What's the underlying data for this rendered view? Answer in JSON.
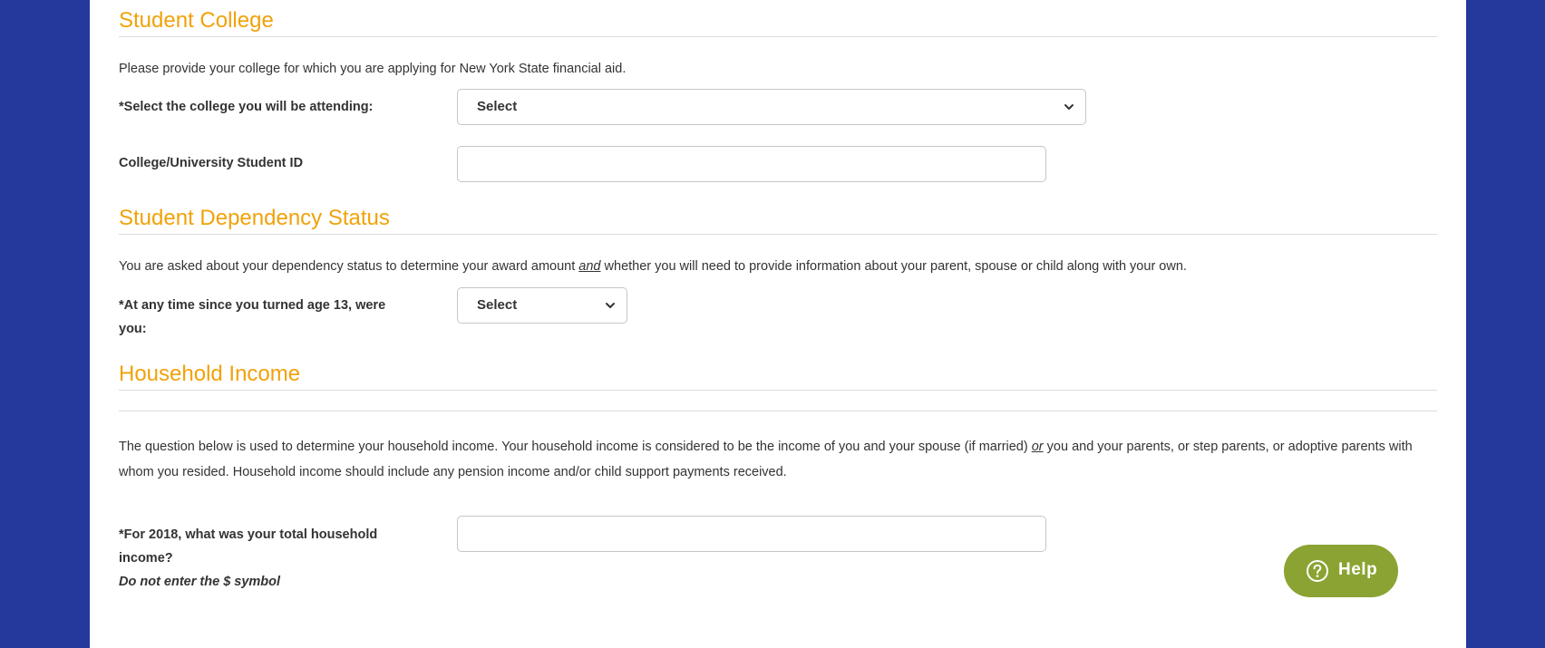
{
  "student_college": {
    "title": "Student College",
    "description": "Please provide your college for which you are applying for New York State financial aid.",
    "college_label": "*Select the college you will be attending:",
    "college_select_value": "Select",
    "student_id_label": "College/University Student ID",
    "student_id_value": ""
  },
  "dependency": {
    "title": "Student Dependency Status",
    "description_before": "You are asked about your dependency status to determine your award amount ",
    "description_emphasis": "and",
    "description_after": " whether you will need to provide information about your parent, spouse or child along with your own.",
    "age_question_label": "*At any time since you turned age 13, were you:",
    "age_question_select_value": "Select"
  },
  "household_income": {
    "title": "Household Income",
    "description_before": "The question below is used to determine your household income. Your household income is considered to be the income of you and your spouse (if married) ",
    "description_emphasis": "or",
    "description_after": " you and your parents, or step parents, or adoptive parents with whom you resided. Household income should include any pension income and/or child support payments received.",
    "income_label": "*For 2018, what was your total household income?",
    "income_note": "Do not enter the $ symbol",
    "income_value": ""
  },
  "help": {
    "label": "Help",
    "icon": "question-circle-icon"
  },
  "colors": {
    "background": "#25389b",
    "heading": "#f0a20a",
    "help_button": "#8aa332"
  }
}
